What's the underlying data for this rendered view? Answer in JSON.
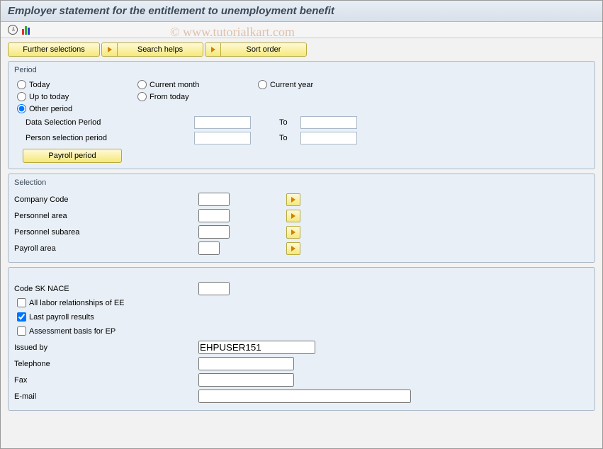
{
  "title": "Employer statement for the entitlement to unemployment benefit",
  "watermark": "© www.tutorialkart.com",
  "top_buttons": {
    "further_selections": "Further selections",
    "search_helps": "Search helps",
    "sort_order": "Sort order"
  },
  "period": {
    "title": "Period",
    "today": "Today",
    "current_month": "Current month",
    "current_year": "Current year",
    "up_to_today": "Up to today",
    "from_today": "From today",
    "other_period": "Other period",
    "data_sel_period": "Data Selection Period",
    "person_sel_period": "Person selection period",
    "to": "To",
    "payroll_period": "Payroll period"
  },
  "selection": {
    "title": "Selection",
    "company_code": "Company Code",
    "personnel_area": "Personnel area",
    "personnel_subarea": "Personnel subarea",
    "payroll_area": "Payroll area"
  },
  "details": {
    "code_sk_nace": "Code SK NACE",
    "all_labor": "All labor relationships of EE",
    "last_payroll": "Last payroll results",
    "assessment": "Assessment basis for EP",
    "issued_by": "Issued by",
    "issued_by_val": "EHPUSER151",
    "telephone": "Telephone",
    "fax": "Fax",
    "email": "E-mail"
  }
}
